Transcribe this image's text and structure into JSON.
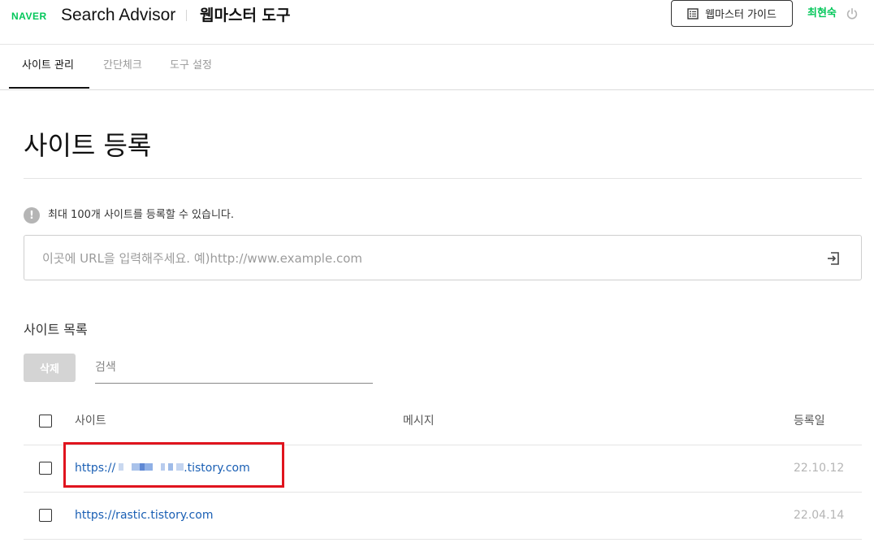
{
  "header": {
    "naver_logo": "NAVER",
    "brand_title": "Search Advisor",
    "brand_subtitle": "웹마스터 도구",
    "guide_button_label": "웹마스터 가이드",
    "user_name": "최현숙"
  },
  "tabs": [
    {
      "label": "사이트 관리",
      "active": true
    },
    {
      "label": "간단체크",
      "active": false
    },
    {
      "label": "도구 설정",
      "active": false
    }
  ],
  "page_title": "사이트 등록",
  "info": {
    "icon": "info-icon",
    "text": "최대 100개 사이트를 등록할 수 있습니다."
  },
  "url_input": {
    "placeholder": "이곳에 URL을 입력해주세요. 예)http://www.example.com",
    "value": ""
  },
  "site_list": {
    "title": "사이트 목록",
    "delete_label": "삭제",
    "search_placeholder": "검색",
    "columns": {
      "site": "사이트",
      "message": "메시지",
      "registered": "등록일"
    },
    "rows": [
      {
        "site_prefix": "https://",
        "site_suffix": ".tistory.com",
        "message": "",
        "date": "22.10.12"
      },
      {
        "site": "https://rastic.tistory.com",
        "message": "",
        "date": "22.04.14"
      }
    ]
  },
  "colors": {
    "brand_green": "#03c75a",
    "link_blue": "#1a5fb4",
    "highlight_red": "#e0141e"
  }
}
